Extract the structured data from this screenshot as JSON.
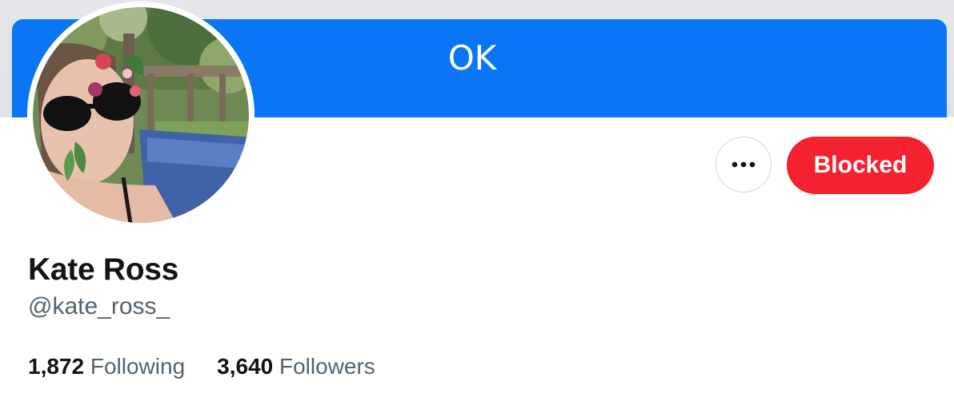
{
  "dialog": {
    "ok_label": "OK",
    "accent_color": "#0b76f5"
  },
  "profile": {
    "display_name": "Kate Ross",
    "handle": "@kate_ross_",
    "avatar_icon": "profile-photo",
    "stats": [
      {
        "count": "1,872",
        "label": "Following"
      },
      {
        "count": "3,640",
        "label": "Followers"
      }
    ]
  },
  "actions": {
    "more_icon": "ellipsis-icon",
    "blocked_label": "Blocked",
    "blocked_color": "#f4212e"
  }
}
